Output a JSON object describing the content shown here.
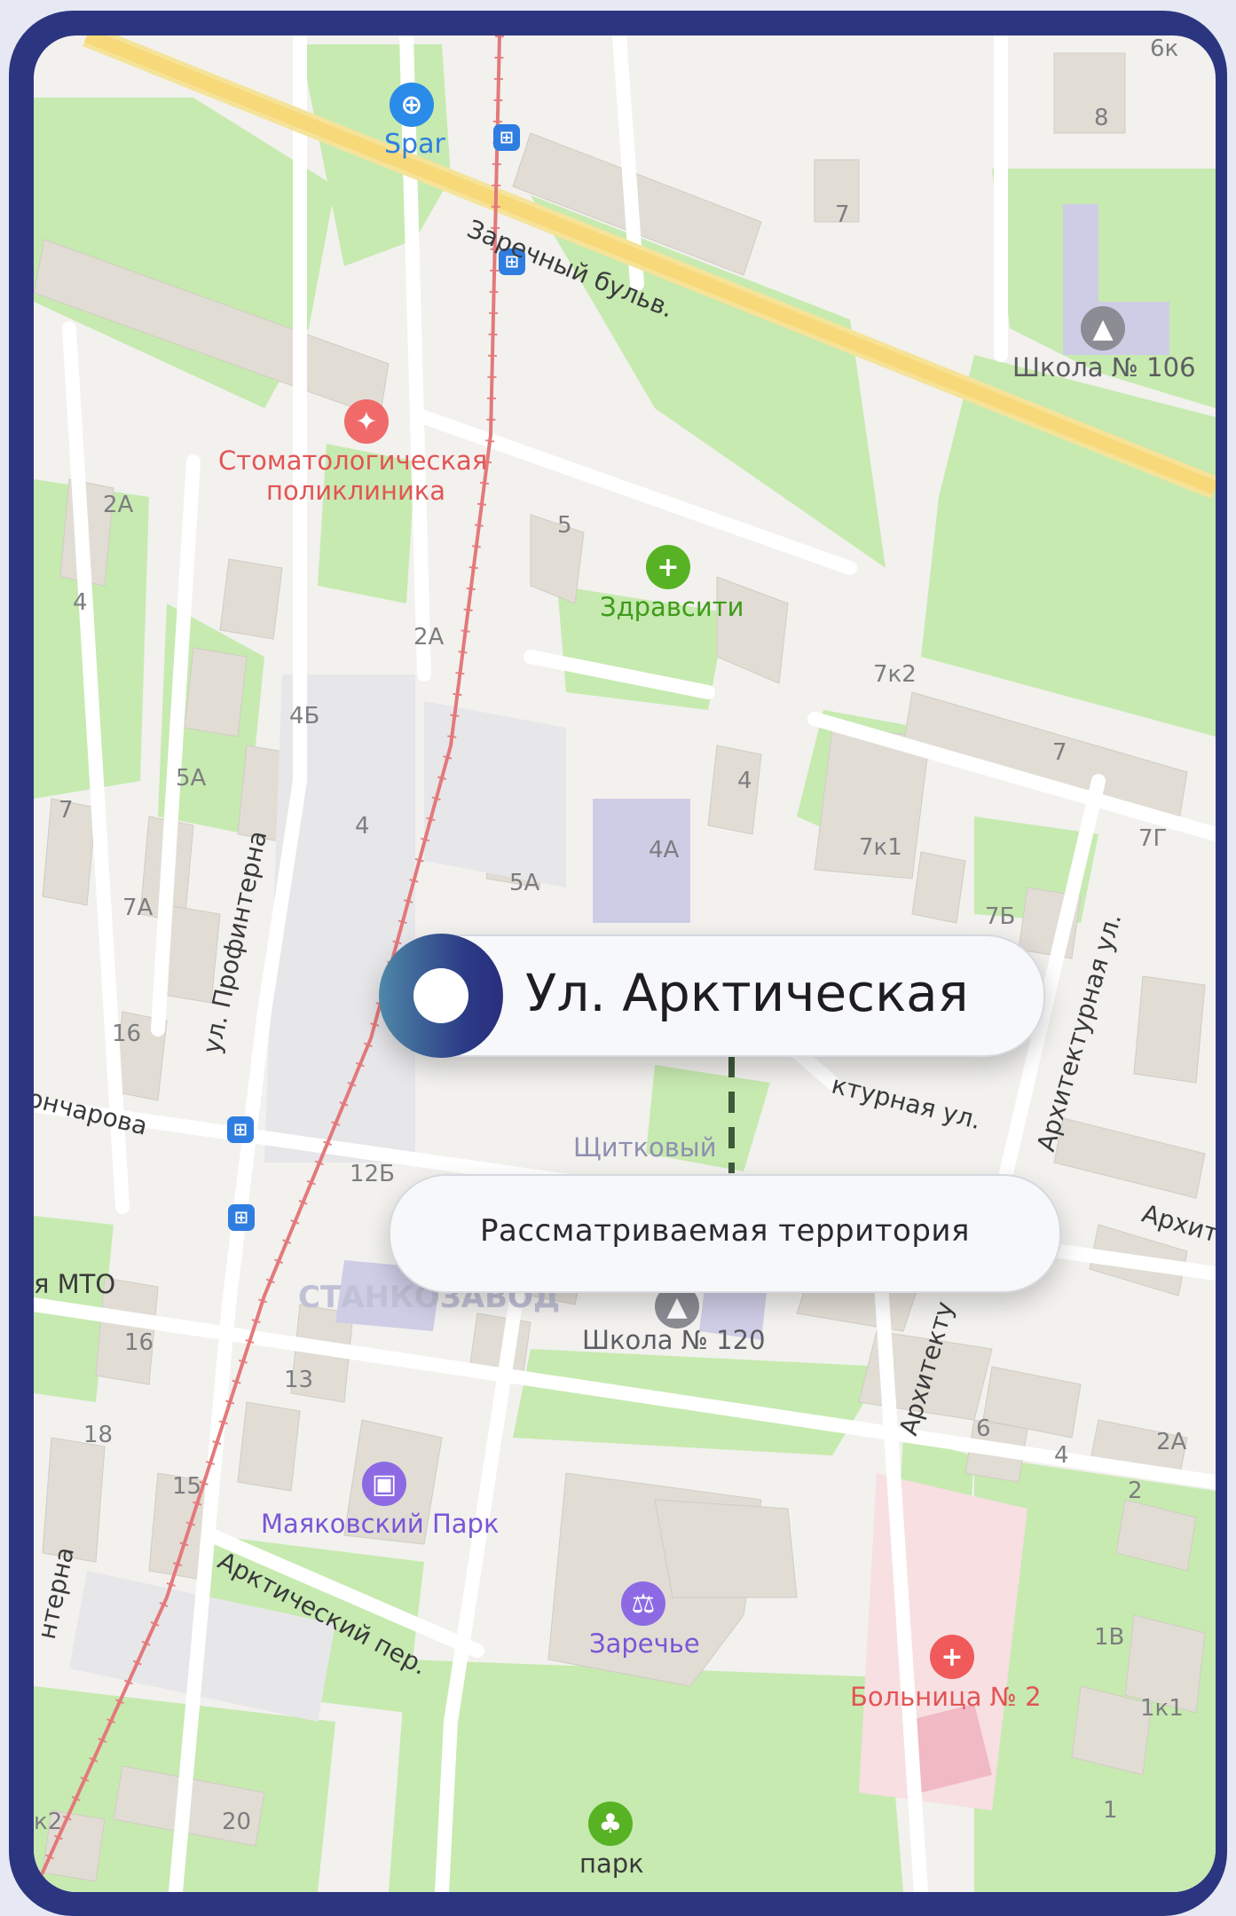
{
  "map": {
    "main_marker_label": "Ул. Арктическая",
    "sub_label": "Рассматриваемая территория",
    "streets": {
      "zarechny": "Заречный бульв.",
      "profinterna": "ул. Профинтерна",
      "profinterna_cut": "нтерна",
      "goncharova_cut": "ончарова",
      "arkticheskiy_per": "Арктический пер.",
      "arhitekturnaya": "Архитектурная ул.",
      "arhitekturnaya_cut": "ктурная ул.",
      "arhitektu_cut": "Архитекту",
      "arhit_cut": "Архит"
    },
    "pois": {
      "spar": "Spar",
      "stomat_line1": "Стоматологическая",
      "stomat_line2": "поликлиника",
      "zdravsiti": "Здравсити",
      "school106": "Школа № 106",
      "school120": "Школа № 120",
      "mayakovsky": "Маяковский Парк",
      "zarechye": "Заречье",
      "hospital": "Больница № 2",
      "park": "парк",
      "shchitkovy": "Щитковый",
      "mto_cut": "я МТО",
      "stankozavod_cut": "СТАНКОЗАВОД"
    },
    "houses": {
      "h8": "8",
      "h7top": "7",
      "h5": "5",
      "h2a_left": "2А",
      "h4_left": "4",
      "h2a_mid": "2А",
      "h4b": "4Б",
      "h5a_left": "5А",
      "h7_left": "7",
      "h4_mid": "4",
      "h7a": "7А",
      "h16_top": "16",
      "h4_right": "4",
      "h4a": "4А",
      "h5a_mid": "5А",
      "h7k2": "7к2",
      "h7_right": "7",
      "h7k1": "7к1",
      "h7g": "7Г",
      "h7b": "7Б",
      "h12b": "12Б",
      "h16_low": "16",
      "h13": "13",
      "h18": "18",
      "h15": "15",
      "h6": "6",
      "h4_low": "4",
      "h2a_low": "2А",
      "h2": "2",
      "h1v": "1В",
      "h1k1": "1к1",
      "h1": "1",
      "h20": "20",
      "hk2": "к2",
      "h6k": "6к"
    }
  }
}
